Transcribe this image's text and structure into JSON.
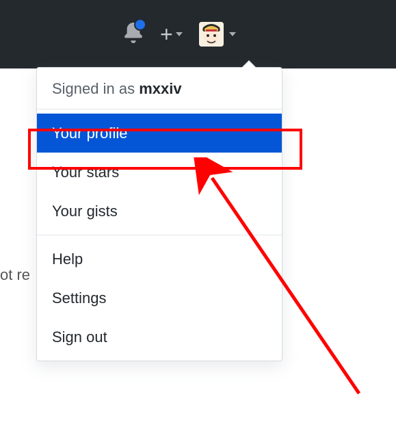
{
  "header": {
    "notification_indicator": true
  },
  "dropdown": {
    "signed_in_prefix": "Signed in as ",
    "username": "mxxiv",
    "items_group1": [
      {
        "label": "Your profile",
        "selected": true
      },
      {
        "label": "Your stars",
        "selected": false
      },
      {
        "label": "Your gists",
        "selected": false
      }
    ],
    "items_group2": [
      {
        "label": "Help"
      },
      {
        "label": "Settings"
      },
      {
        "label": "Sign out"
      }
    ]
  },
  "background": {
    "partial_text": "ot re"
  },
  "annotation": {
    "highlight_target": "Your profile",
    "arrow_color": "#ff0000"
  }
}
